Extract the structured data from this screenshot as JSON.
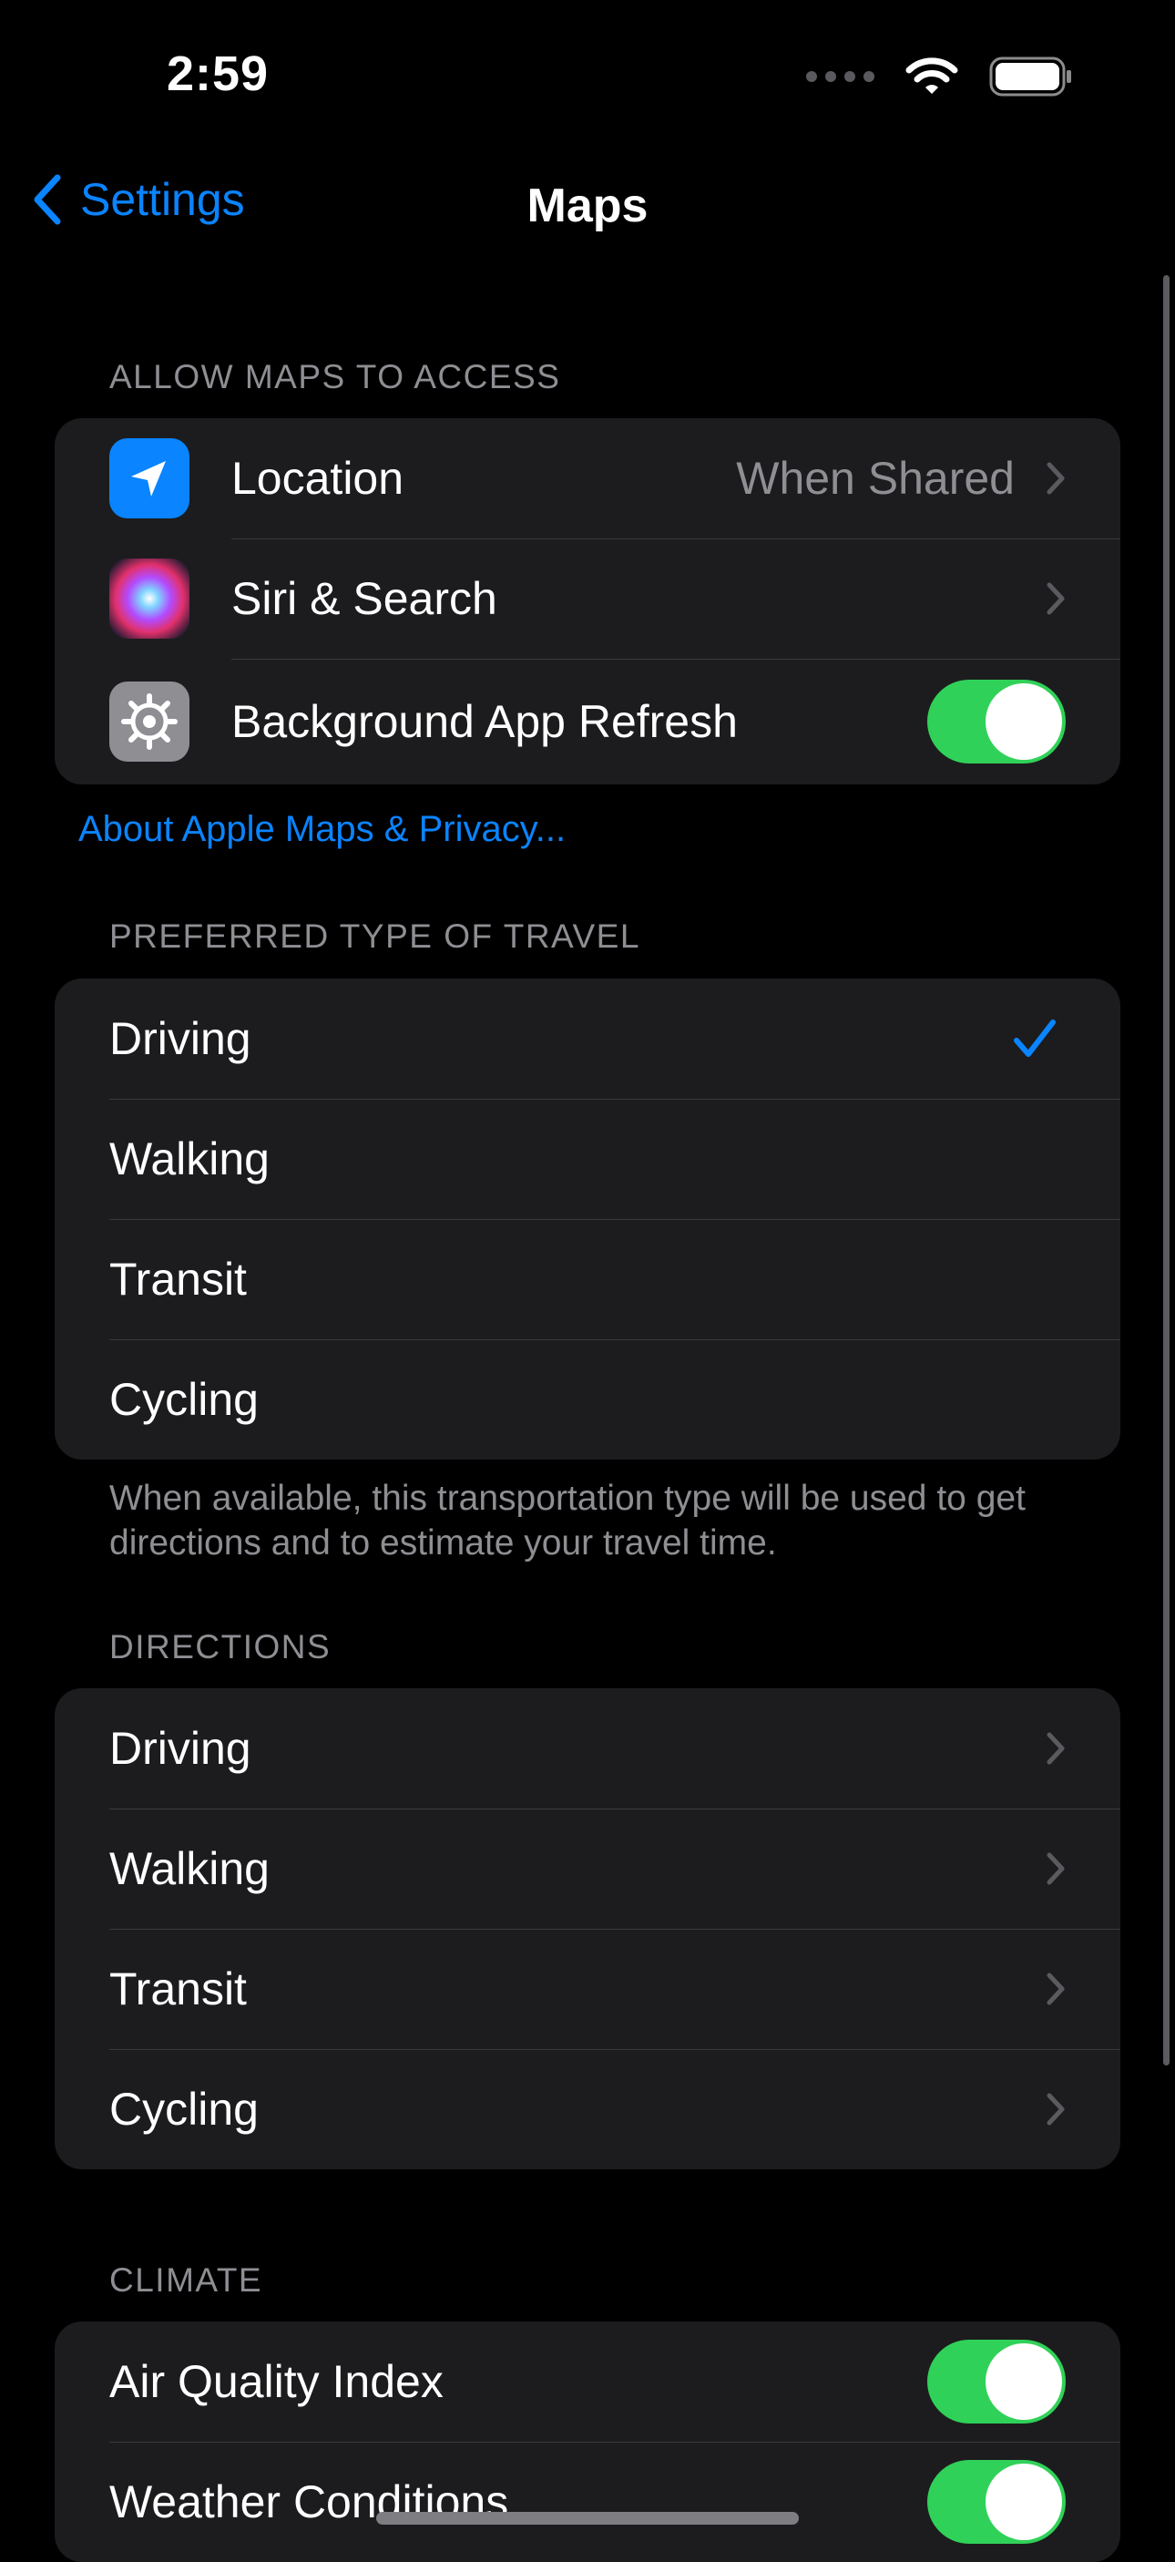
{
  "status_bar": {
    "time": "2:59"
  },
  "nav": {
    "back_label": "Settings",
    "title": "Maps"
  },
  "access_section": {
    "header": "ALLOW MAPS TO ACCESS",
    "items": [
      {
        "label": "Location",
        "value": "When Shared",
        "icon": "location-arrow-icon"
      },
      {
        "label": "Siri & Search",
        "icon": "siri-icon"
      },
      {
        "label": "Background App Refresh",
        "icon": "gear-icon",
        "toggle_on": true
      }
    ],
    "footer_link": "About Apple Maps & Privacy..."
  },
  "travel_section": {
    "header": "PREFERRED TYPE OF TRAVEL",
    "items": [
      {
        "label": "Driving",
        "selected": true
      },
      {
        "label": "Walking"
      },
      {
        "label": "Transit"
      },
      {
        "label": "Cycling"
      }
    ],
    "footer": "When available, this transportation type will be used to get directions and to estimate your travel time."
  },
  "directions_section": {
    "header": "DIRECTIONS",
    "items": [
      {
        "label": "Driving"
      },
      {
        "label": "Walking"
      },
      {
        "label": "Transit"
      },
      {
        "label": "Cycling"
      }
    ]
  },
  "climate_section": {
    "header": "CLIMATE",
    "items": [
      {
        "label": "Air Quality Index",
        "toggle_on": true
      },
      {
        "label": "Weather Conditions",
        "toggle_on": true
      }
    ]
  },
  "colors": {
    "accent": "#0a84ff",
    "toggle_on": "#30d158",
    "background": "#000000",
    "group_background": "#1c1c1e",
    "secondary_text": "#8e8e93"
  }
}
